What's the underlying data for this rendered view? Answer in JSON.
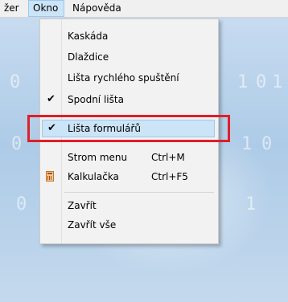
{
  "menubar": {
    "items": [
      {
        "label": "žer"
      },
      {
        "label": "Okno"
      },
      {
        "label": "Nápověda"
      }
    ]
  },
  "window_menu": {
    "items": [
      {
        "label": "Kaskáda"
      },
      {
        "label": "Dlaždice"
      },
      {
        "label": "Lišta rychlého spuštění"
      },
      {
        "label": "Spodní lišta",
        "checked": true
      },
      {
        "label": "Lišta formulářů",
        "checked": true,
        "highlighted": true
      },
      {
        "label": "Strom menu",
        "shortcut": "Ctrl+M"
      },
      {
        "label": "Kalkulačka",
        "shortcut": "Ctrl+F5",
        "icon": "calculator-icon"
      },
      {
        "label": "Zavřít"
      },
      {
        "label": "Zavřít vše"
      }
    ]
  },
  "desktop": {
    "digits": [
      "0",
      "1",
      "0",
      "1",
      "0",
      "1",
      "0",
      "0",
      "1"
    ]
  },
  "colors": {
    "annotation": "#e01f26",
    "highlight": "#cce4f7",
    "menu_background": "#f2f2f2"
  }
}
